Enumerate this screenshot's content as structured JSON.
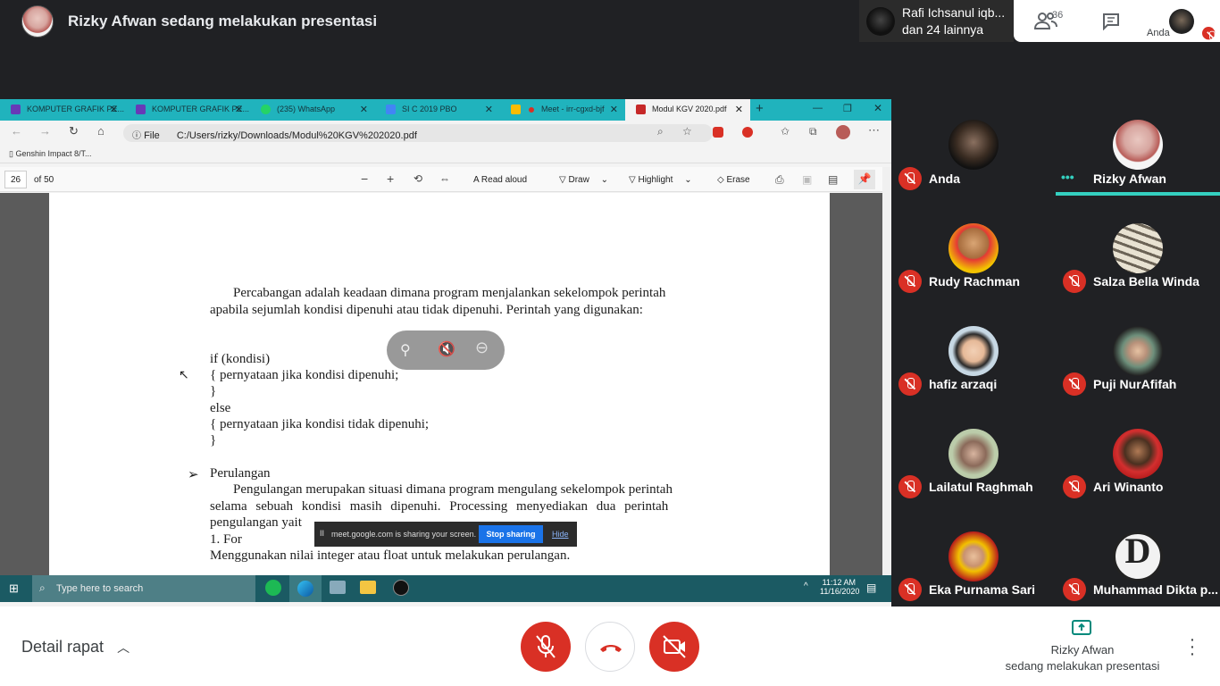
{
  "meet": {
    "presenter_title": "Rizky Afwan sedang melakukan presentasi",
    "notification": {
      "line1": "Rafi Ichsanul iqb...",
      "line2": "dan 24 lainnya"
    },
    "participant_count": "36",
    "self_label": "Anda",
    "accent": "#d93025"
  },
  "browser": {
    "tabs": [
      {
        "label": "KOMPUTER GRAFIK PE..."
      },
      {
        "label": "KOMPUTER GRAFIK PE..."
      },
      {
        "label": "(235) WhatsApp"
      },
      {
        "label": "SI C 2019 PBO"
      },
      {
        "label": "Meet - irr-cgxd-bjf"
      },
      {
        "label": "Modul KGV 2020.pdf"
      }
    ],
    "file_label": "File",
    "url": "C:/Users/rizky/Downloads/Modul%20KGV%202020.pdf",
    "bookmark": "Genshin Impact 8/T...",
    "pdf_toolbar": {
      "page": "26",
      "of_pages": "of 50",
      "read_aloud": "Read aloud",
      "draw": "Draw",
      "highlight": "Highlight",
      "erase": "Erase"
    }
  },
  "pdf": {
    "lines": [
      "Percabangan adalah keadaan dimana program menjalankan sekelompok perintah",
      "apabila sejumlah kondisi dipenuhi atau tidak dipenuhi. Perintah yang digunakan:",
      "if (kondisi)",
      "{ pernyataan jika kondisi dipenuhi;",
      "}",
      "else",
      "{ pernyataan jika kondisi tidak dipenuhi;",
      "}",
      "Perulangan",
      "Pengulangan merupakan situasi dimana program mengulang sekelompok perintah",
      "selama sebuah kondisi masih dipenuhi. Processing menyediakan dua perintah",
      "pengulangan yait",
      "1. For",
      "Menggunakan nilai integer atau float untuk melakukan perulangan."
    ]
  },
  "share_banner": {
    "text": "meet.google.com is sharing your screen.",
    "stop": "Stop sharing",
    "hide": "Hide"
  },
  "taskbar": {
    "search": "Type here to search",
    "time": "11:12 AM",
    "date": "11/16/2020"
  },
  "participants": [
    {
      "name": "Anda"
    },
    {
      "name": "Rizky Afwan"
    },
    {
      "name": "Rudy Rachman"
    },
    {
      "name": "Salza Bella Winda"
    },
    {
      "name": "hafiz arzaqi"
    },
    {
      "name": "Puji NurAfifah"
    },
    {
      "name": "Lailatul Raghmah"
    },
    {
      "name": "Ari Winanto"
    },
    {
      "name": "Eka Purnama Sari"
    },
    {
      "name": "Muhammad Dikta p..."
    }
  ],
  "bottom": {
    "detail": "Detail rapat",
    "presenting_name": "Rizky Afwan",
    "presenting_text": "sedang melakukan presentasi"
  }
}
